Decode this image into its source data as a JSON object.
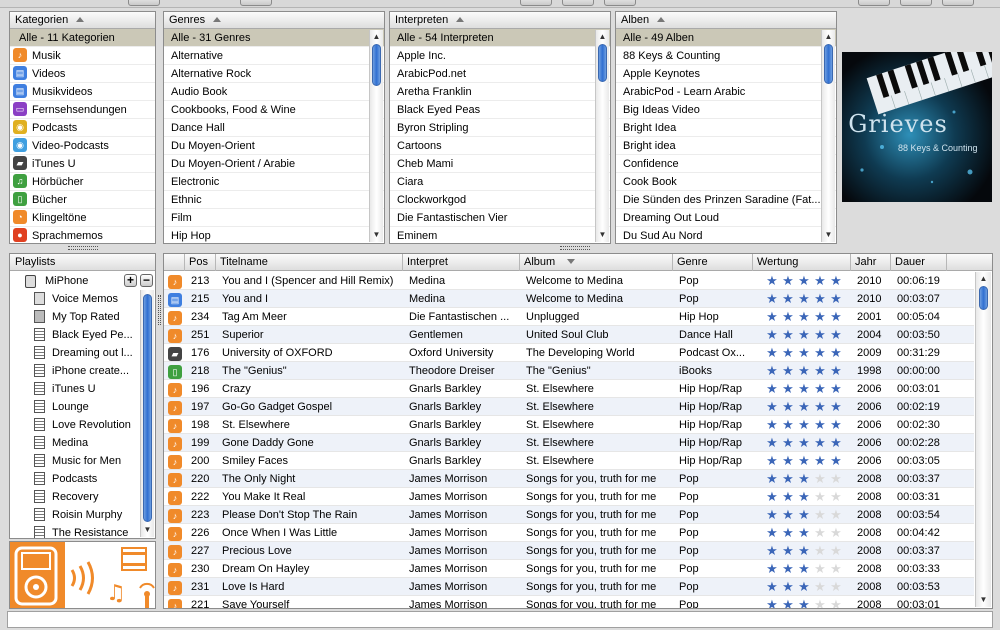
{
  "colors": {
    "selection": "#cbc8b7",
    "accent": "#2f6fd1",
    "star": "#3b66b8",
    "star_empty": "#d9d9d9",
    "device_orange": "#f08a2a"
  },
  "categories": {
    "header": "Kategorien",
    "items": [
      {
        "label": "Alle - 11 Kategorien",
        "icon": "none",
        "selected": true
      },
      {
        "label": "Musik",
        "icon": "music-icon"
      },
      {
        "label": "Videos",
        "icon": "video-icon"
      },
      {
        "label": "Musikvideos",
        "icon": "music-video-icon"
      },
      {
        "label": "Fernsehsendungen",
        "icon": "tv-icon"
      },
      {
        "label": "Podcasts",
        "icon": "podcast-icon"
      },
      {
        "label": "Video-Podcasts",
        "icon": "video-podcast-icon"
      },
      {
        "label": "iTunes U",
        "icon": "itunes-u-icon"
      },
      {
        "label": "Hörbücher",
        "icon": "audiobook-icon"
      },
      {
        "label": "Bücher",
        "icon": "book-icon"
      },
      {
        "label": "Klingeltöne",
        "icon": "ringtone-icon"
      },
      {
        "label": "Sprachmemos",
        "icon": "voice-memo-icon"
      }
    ]
  },
  "genres": {
    "header": "Genres",
    "items": [
      "Alle - 31 Genres",
      "Alternative",
      "Alternative Rock",
      "Audio Book",
      "Cookbooks, Food & Wine",
      "Dance Hall",
      "Du Moyen-Orient",
      "Du Moyen-Orient / Arabie",
      "Electronic",
      "Ethnic",
      "Film",
      "Hip Hop"
    ]
  },
  "artists": {
    "header": "Interpreten",
    "items": [
      "Alle - 54 Interpreten",
      "Apple Inc.",
      "ArabicPod.net",
      "Aretha Franklin",
      "Black Eyed Peas",
      "Byron Stripling",
      "Cartoons",
      "Cheb Mami",
      "Ciara",
      "Clockworkgod",
      "Die Fantastischen Vier",
      "Eminem"
    ]
  },
  "albums": {
    "header": "Alben",
    "items": [
      "Alle - 49 Alben",
      "88 Keys & Counting",
      "Apple Keynotes",
      "ArabicPod - Learn Arabic",
      "Big Ideas Video",
      "Bright Idea",
      "Bright idea",
      "Confidence",
      "Cook Book",
      "Die Sünden des Prinzen Saradine (Fat...",
      "Dreaming Out Loud",
      "Du Sud Au Nord"
    ]
  },
  "album_art": {
    "title": "Grieves",
    "subtitle": "88 Keys & Counting"
  },
  "playlists": {
    "header": "Playlists",
    "device": "MiPhone",
    "items": [
      "Voice Memos",
      "My Top Rated",
      "Black Eyed Pe...",
      "Dreaming out l...",
      "iPhone create...",
      "iTunes U",
      "Lounge",
      "Love Revolution",
      "Medina",
      "Music for Men",
      "Podcasts",
      "Recovery",
      "Roisin Murphy",
      "The Resistance"
    ]
  },
  "tracks": {
    "columns": [
      "Pos",
      "Titelname",
      "Interpret",
      "Album",
      "Genre",
      "Wertung",
      "Jahr",
      "Dauer"
    ],
    "rows": [
      {
        "icon": "music",
        "pos": "213",
        "title": "You and I (Spencer and Hill Remix)",
        "artist": "Medina",
        "album": "Welcome to Medina",
        "genre": "Pop",
        "rating": 5,
        "year": "2010",
        "duration": "00:06:19"
      },
      {
        "icon": "video",
        "pos": "215",
        "title": "You and I",
        "artist": "Medina",
        "album": "Welcome to Medina",
        "genre": "Pop",
        "rating": 5,
        "year": "2010",
        "duration": "00:03:07"
      },
      {
        "icon": "music",
        "pos": "234",
        "title": "Tag Am Meer",
        "artist": "Die Fantastischen ...",
        "album": "Unplugged",
        "genre": "Hip Hop",
        "rating": 5,
        "year": "2001",
        "duration": "00:05:04"
      },
      {
        "icon": "music",
        "pos": "251",
        "title": "Superior",
        "artist": "Gentlemen",
        "album": "United Soul Club",
        "genre": "Dance Hall",
        "rating": 5,
        "year": "2004",
        "duration": "00:03:50"
      },
      {
        "icon": "itunesu",
        "pos": "176",
        "title": "University of OXFORD",
        "artist": "Oxford University",
        "album": "The Developing World",
        "genre": "Podcast Ox...",
        "rating": 5,
        "year": "2009",
        "duration": "00:31:29"
      },
      {
        "icon": "book",
        "pos": "218",
        "title": "The \"Genius\"",
        "artist": "Theodore Dreiser",
        "album": "The \"Genius\"",
        "genre": "iBooks",
        "rating": 5,
        "year": "1998",
        "duration": "00:00:00"
      },
      {
        "icon": "music",
        "pos": "196",
        "title": "Crazy",
        "artist": "Gnarls Barkley",
        "album": "St. Elsewhere",
        "genre": "Hip Hop/Rap",
        "rating": 5,
        "year": "2006",
        "duration": "00:03:01"
      },
      {
        "icon": "music",
        "pos": "197",
        "title": "Go-Go Gadget Gospel",
        "artist": "Gnarls Barkley",
        "album": "St. Elsewhere",
        "genre": "Hip Hop/Rap",
        "rating": 5,
        "year": "2006",
        "duration": "00:02:19"
      },
      {
        "icon": "music",
        "pos": "198",
        "title": "St. Elsewhere",
        "artist": "Gnarls Barkley",
        "album": "St. Elsewhere",
        "genre": "Hip Hop/Rap",
        "rating": 5,
        "year": "2006",
        "duration": "00:02:30"
      },
      {
        "icon": "music",
        "pos": "199",
        "title": "Gone Daddy Gone",
        "artist": "Gnarls Barkley",
        "album": "St. Elsewhere",
        "genre": "Hip Hop/Rap",
        "rating": 5,
        "year": "2006",
        "duration": "00:02:28"
      },
      {
        "icon": "music",
        "pos": "200",
        "title": "Smiley Faces",
        "artist": "Gnarls Barkley",
        "album": "St. Elsewhere",
        "genre": "Hip Hop/Rap",
        "rating": 5,
        "year": "2006",
        "duration": "00:03:05"
      },
      {
        "icon": "music",
        "pos": "220",
        "title": "The Only Night",
        "artist": "James Morrison",
        "album": "Songs for you, truth for me",
        "genre": "Pop",
        "rating": 3,
        "year": "2008",
        "duration": "00:03:37"
      },
      {
        "icon": "music",
        "pos": "222",
        "title": "You Make It Real",
        "artist": "James Morrison",
        "album": "Songs for you, truth for me",
        "genre": "Pop",
        "rating": 3,
        "year": "2008",
        "duration": "00:03:31"
      },
      {
        "icon": "music",
        "pos": "223",
        "title": "Please Don't Stop The Rain",
        "artist": "James Morrison",
        "album": "Songs for you, truth for me",
        "genre": "Pop",
        "rating": 3,
        "year": "2008",
        "duration": "00:03:54"
      },
      {
        "icon": "music",
        "pos": "226",
        "title": "Once When I Was Little",
        "artist": "James Morrison",
        "album": "Songs for you, truth for me",
        "genre": "Pop",
        "rating": 3,
        "year": "2008",
        "duration": "00:04:42"
      },
      {
        "icon": "music",
        "pos": "227",
        "title": "Precious Love",
        "artist": "James Morrison",
        "album": "Songs for you, truth for me",
        "genre": "Pop",
        "rating": 3,
        "year": "2008",
        "duration": "00:03:37"
      },
      {
        "icon": "music",
        "pos": "230",
        "title": "Dream On Hayley",
        "artist": "James Morrison",
        "album": "Songs for you, truth for me",
        "genre": "Pop",
        "rating": 3,
        "year": "2008",
        "duration": "00:03:33"
      },
      {
        "icon": "music",
        "pos": "231",
        "title": "Love Is Hard",
        "artist": "James Morrison",
        "album": "Songs for you, truth for me",
        "genre": "Pop",
        "rating": 3,
        "year": "2008",
        "duration": "00:03:53"
      },
      {
        "icon": "music",
        "pos": "221",
        "title": "Save Yourself",
        "artist": "James Morrison",
        "album": "Songs for you, truth for me",
        "genre": "Pop",
        "rating": 3,
        "year": "2008",
        "duration": "00:03:01"
      }
    ]
  }
}
